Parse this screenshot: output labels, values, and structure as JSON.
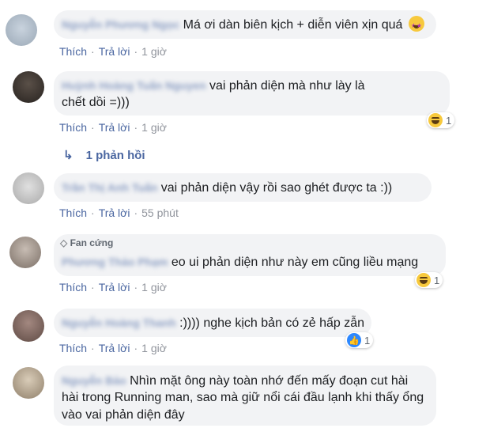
{
  "labels": {
    "like": "Thích",
    "reply": "Trả lời",
    "dot": "·"
  },
  "comments": [
    {
      "author": "Nguyễn Phương Ngọc",
      "text": "Má ơi dàn biên kịch + diễn viên xịn quá",
      "time": "1 giờ",
      "emoji": "star-struck-icon"
    },
    {
      "author": "Huỳnh Hoàng Tuấn Nguyen",
      "text_inline": "vai phản diện mà như lày là",
      "text_line2": "chết dồi =)))",
      "time": "1 giờ",
      "reaction": "haha",
      "reaction_count": "1"
    },
    {
      "author": "Trần Thị Anh Tuấn",
      "text": "vai phản diện vậy rồi sao ghét được ta :))",
      "time": "55 phút"
    },
    {
      "badge": "Fan cứng",
      "author": "Phương Thảo Phạm",
      "text": "eo ui phản diện như này em cũng liều mạng",
      "time": "1 giờ",
      "reaction": "haha",
      "reaction_count": "1"
    },
    {
      "author": "Nguyễn Hoàng Thanh",
      "text": ":)))) nghe kịch bản có zẻ hấp zẫn",
      "time": "1 giờ",
      "reaction": "like",
      "reaction_count": "1"
    },
    {
      "author": "Nguyễn Bảo",
      "text_inline": "Nhìn mặt ông này toàn nhớ đến mấy đoạn cut hài",
      "text_line2": "hài trong Running man, sao mà giữ nổi cái đầu lạnh khi thấy ổng",
      "text_line3": "vào vai phản diện đây"
    }
  ],
  "replies_link": "1 phản hồi",
  "colors": {
    "bubble": "#f2f3f5",
    "link": "#4b67a1",
    "meta": "#90949c"
  }
}
